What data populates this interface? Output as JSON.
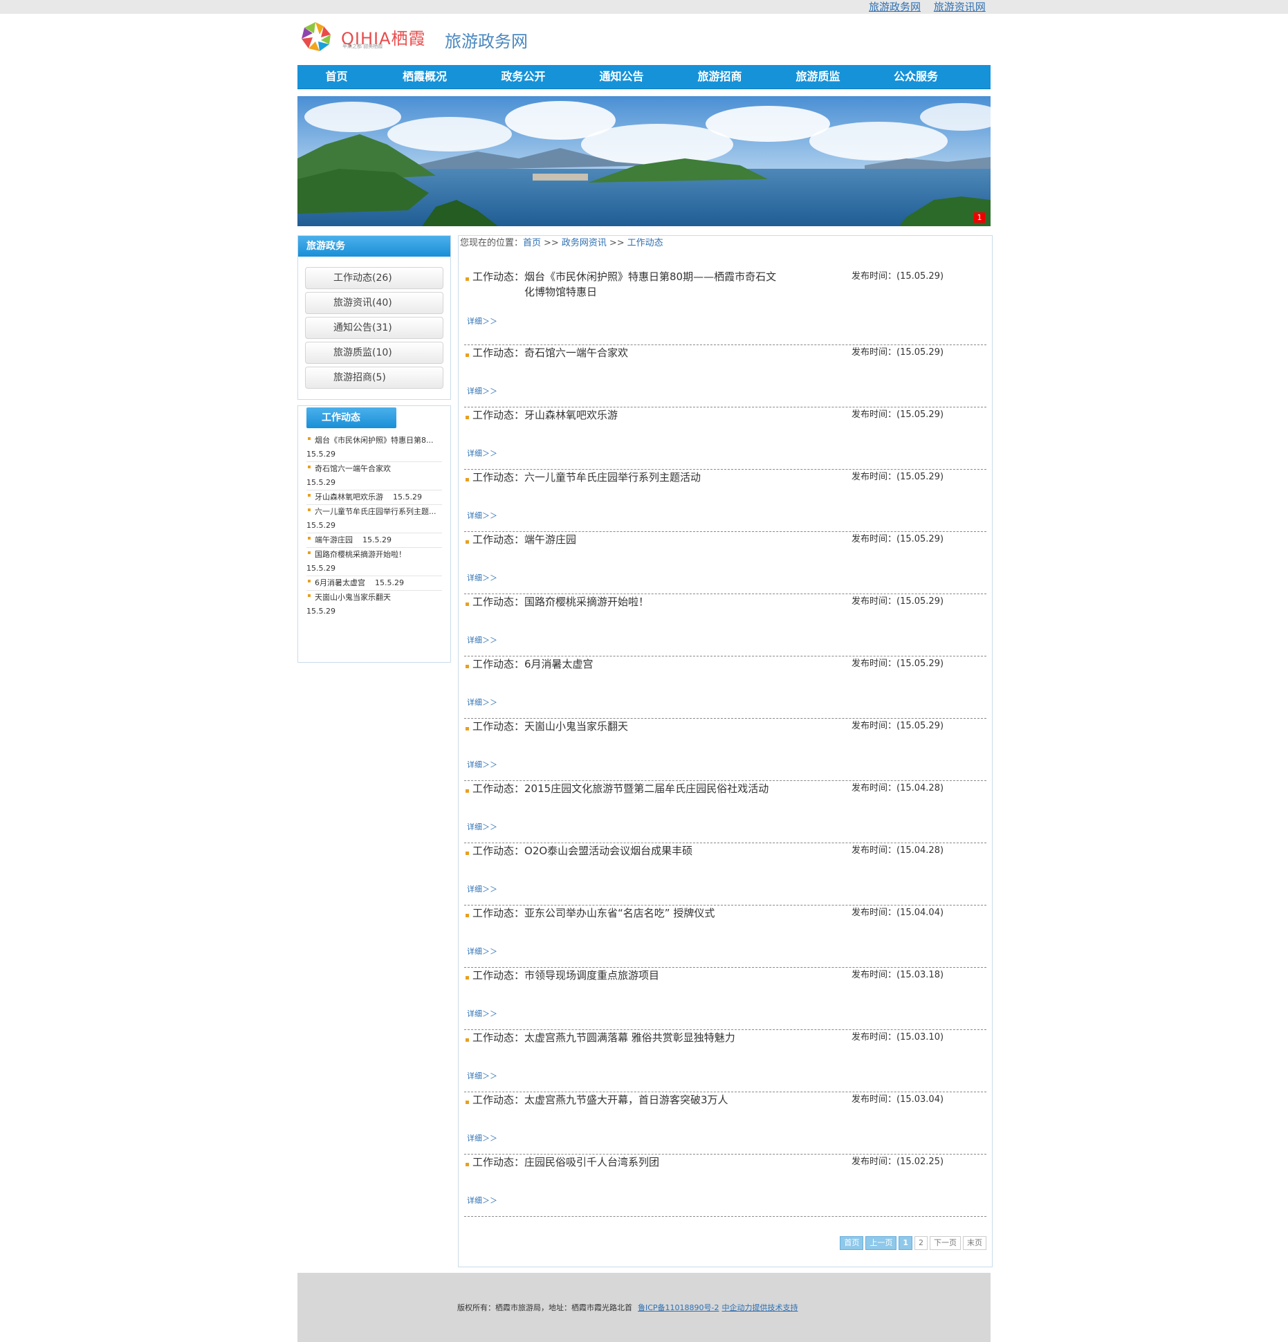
{
  "top_links": [
    "旅游政务网",
    "旅游资讯网"
  ],
  "header": {
    "logo_text": "QIHIA栖霞",
    "logo_slogan": "苹果之都  甜美栖霞",
    "site_name": "旅游政务网"
  },
  "nav": [
    "首页",
    "栖霞概况",
    "政务公开",
    "通知公告",
    "旅游招商",
    "旅游质监",
    "公众服务"
  ],
  "banner": {
    "counter": "1"
  },
  "sidebar": {
    "section_title": "旅游政务",
    "categories": [
      "工作动态(26)",
      "旅游资讯(40)",
      "通知公告(31)",
      "旅游质监(10)",
      "旅游招商(5)"
    ],
    "news_title": "工作动态",
    "news": [
      {
        "title": "烟台《市民休闲护照》特惠日第8...",
        "date": "15.5.29"
      },
      {
        "title": "奇石馆六一端午合家欢",
        "date": "15.5.29"
      },
      {
        "title": "牙山森林氧吧欢乐游",
        "date": "15.5.29"
      },
      {
        "title": "六一儿童节牟氏庄园举行系列主题...",
        "date": "15.5.29"
      },
      {
        "title": "端午游庄园",
        "date": "15.5.29"
      },
      {
        "title": "国路夼樱桃采摘游开始啦！",
        "date": "15.5.29"
      },
      {
        "title": "6月消暑太虚宫",
        "date": "15.5.29"
      },
      {
        "title": "天崮山小鬼当家乐翻天",
        "date": "15.5.29"
      }
    ]
  },
  "breadcrumb": {
    "label": "您现在的位置：",
    "items": [
      "首页",
      "政务网资讯",
      "工作动态"
    ],
    "sep": ">>"
  },
  "list": {
    "prefix": "工作动态：",
    "pub_label": "发布时间：",
    "more_label": "详细＞＞",
    "items": [
      {
        "title": "烟台《市民休闲护照》特惠日第80期——栖霞市奇石文化博物馆特惠日",
        "date": "(15.05.29)"
      },
      {
        "title": "奇石馆六一端午合家欢",
        "date": "(15.05.29)"
      },
      {
        "title": "牙山森林氧吧欢乐游",
        "date": "(15.05.29)"
      },
      {
        "title": "六一儿童节牟氏庄园举行系列主题活动",
        "date": "(15.05.29)"
      },
      {
        "title": "端午游庄园",
        "date": "(15.05.29)"
      },
      {
        "title": "国路夼樱桃采摘游开始啦！",
        "date": "(15.05.29)"
      },
      {
        "title": "6月消暑太虚宫",
        "date": "(15.05.29)"
      },
      {
        "title": "天崮山小鬼当家乐翻天",
        "date": "(15.05.29)"
      },
      {
        "title": "2015庄园文化旅游节暨第二届牟氏庄园民俗社戏活动",
        "date": "(15.04.28)"
      },
      {
        "title": "O2O泰山会盟活动会议烟台成果丰硕",
        "date": "(15.04.28)"
      },
      {
        "title": "亚东公司举办山东省“名店名吃” 授牌仪式",
        "date": "(15.04.04)"
      },
      {
        "title": "市领导现场调度重点旅游项目",
        "date": "(15.03.18)"
      },
      {
        "title": "太虚宫燕九节圆满落幕 雅俗共赏彰显独特魅力",
        "date": "(15.03.10)"
      },
      {
        "title": "太虚宫燕九节盛大开幕，首日游客突破3万人",
        "date": "(15.03.04)"
      },
      {
        "title": "庄园民俗吸引千人台湾系列团",
        "date": "(15.02.25)"
      }
    ]
  },
  "pager": [
    "首页",
    "上一页",
    "1",
    "2",
    "下一页",
    "末页"
  ],
  "footer": {
    "text": "版权所有：栖霞市旅游局，地址：栖霞市霞光路北首",
    "icp": "鲁ICP备11018890号-2",
    "support": "中企动力提供技术支持"
  },
  "colors": {
    "nav_blue": "#1692d8",
    "link_blue": "#2d6fb2",
    "bullet_orange": "#e8a020"
  }
}
